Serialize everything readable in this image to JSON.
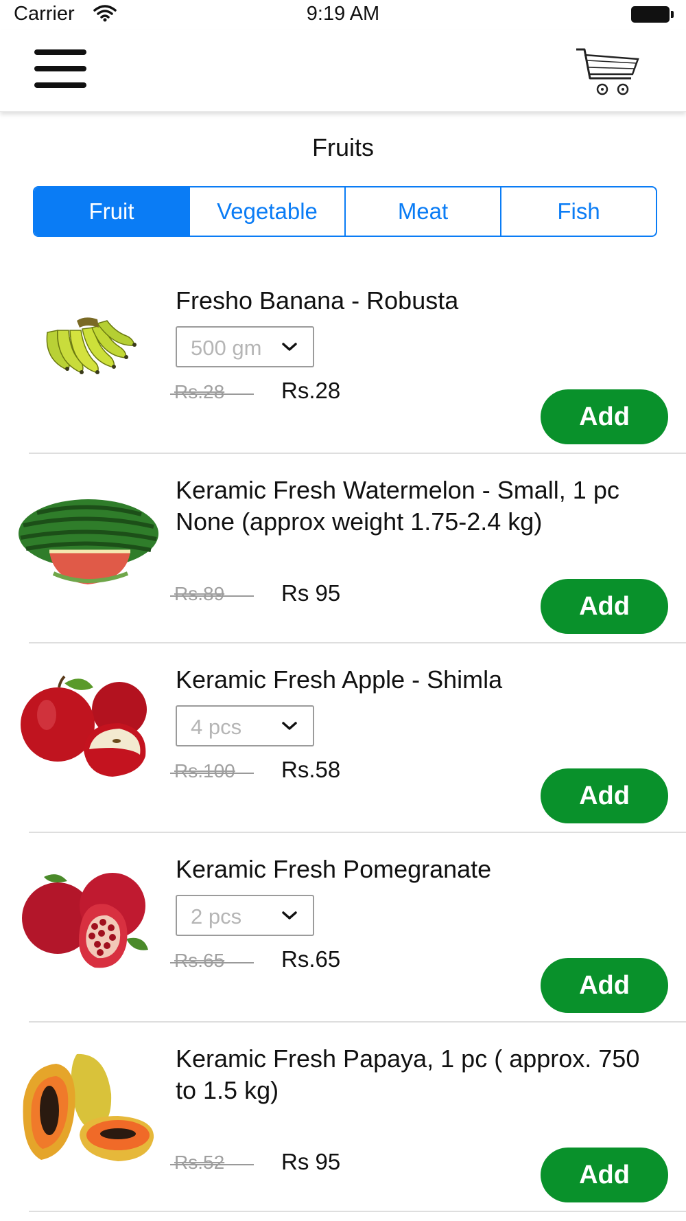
{
  "status_bar": {
    "carrier": "Carrier",
    "time": "9:19 AM"
  },
  "nav": {
    "menu_icon": "hamburger-menu-icon",
    "cart_icon": "shopping-cart-icon"
  },
  "page_title": "Fruits",
  "tabs": [
    {
      "label": "Fruit",
      "selected": true
    },
    {
      "label": "Vegetable",
      "selected": false
    },
    {
      "label": "Meat",
      "selected": false
    },
    {
      "label": "Fish",
      "selected": false
    }
  ],
  "colors": {
    "accent": "#0a7cf5",
    "add_button": "#09912b"
  },
  "products": [
    {
      "name": "Fresho Banana - Robusta",
      "qty": "500 gm",
      "old_price": "Rs.28",
      "price": "Rs.28",
      "add_label": "Add",
      "image": "banana"
    },
    {
      "name": "Keramic Fresh Watermelon - Small, 1 pc None (approx weight 1.75-2.4 kg)",
      "qty": null,
      "old_price": "Rs.89",
      "price": "Rs 95",
      "add_label": "Add",
      "image": "watermelon"
    },
    {
      "name": "Keramic Fresh Apple - Shimla",
      "qty": "4 pcs",
      "old_price": "Rs.100",
      "price": "Rs.58",
      "add_label": "Add",
      "image": "apple"
    },
    {
      "name": "Keramic Fresh Pomegranate",
      "qty": "2 pcs",
      "old_price": "Rs.65",
      "price": "Rs.65",
      "add_label": "Add",
      "image": "pomegranate"
    },
    {
      "name": "Keramic Fresh Papaya, 1 pc ( approx. 750 to 1.5 kg)",
      "qty": null,
      "old_price": "Rs.52",
      "price": "Rs 95",
      "add_label": "Add",
      "image": "papaya"
    }
  ]
}
